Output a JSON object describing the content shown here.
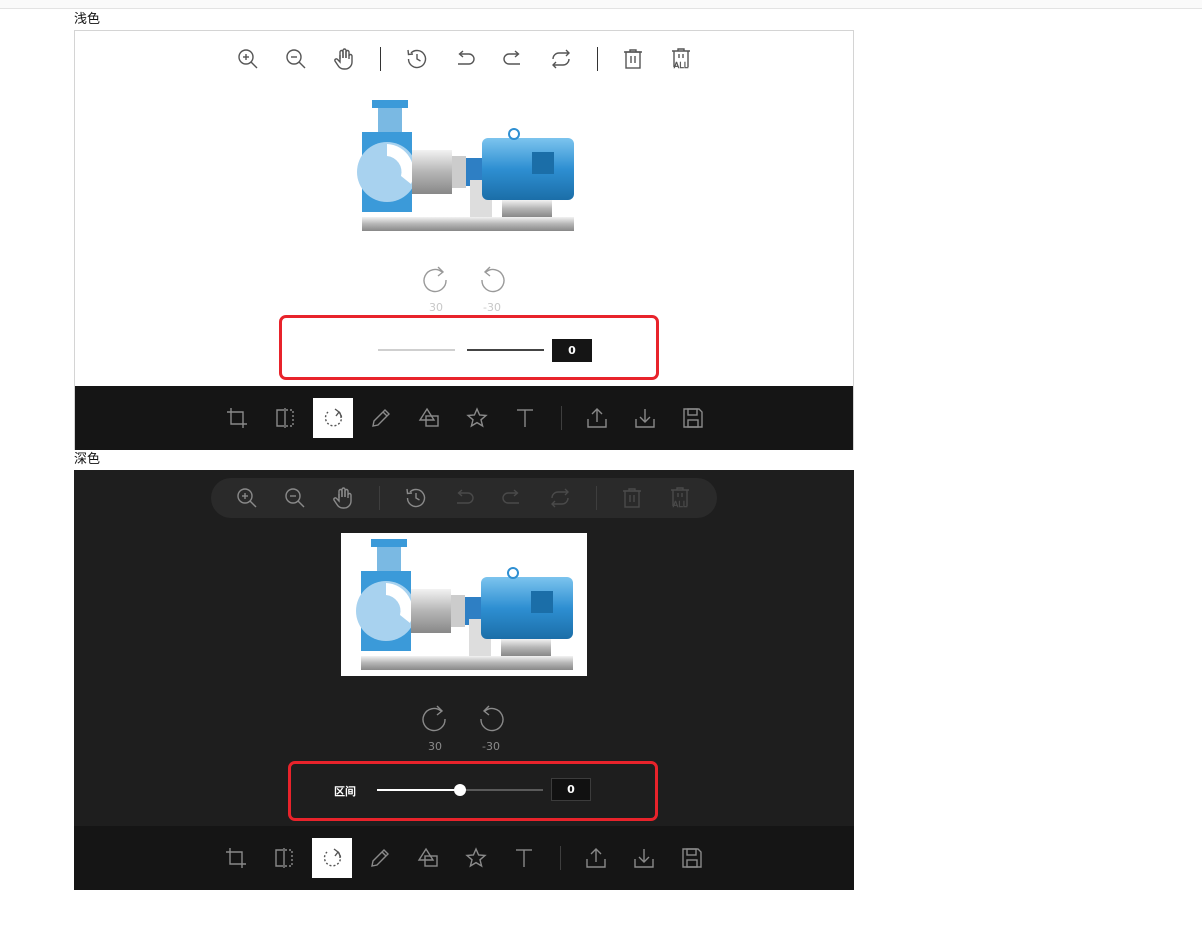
{
  "sections": [
    {
      "label": "浅色",
      "theme": "light"
    },
    {
      "label": "深色",
      "theme": "dark"
    }
  ],
  "header_icons": [
    "zoom-in-icon",
    "zoom-out-icon",
    "hand-icon",
    "history-icon",
    "undo-icon",
    "redo-icon",
    "reset-icon",
    "delete-icon",
    "delete-all-icon"
  ],
  "header_text": {
    "delete_all": "ALL"
  },
  "rotate": {
    "cw_label": "30",
    "ccw_label": "-30"
  },
  "range": {
    "label": "区间",
    "value": "0",
    "slider_fraction": 0.5
  },
  "menu_icons": [
    "crop-icon",
    "flip-icon",
    "rotate-icon",
    "draw-icon",
    "shape-icon",
    "icon-star-icon",
    "text-icon",
    "upload-icon",
    "download-icon",
    "save-icon"
  ],
  "active_menu": "rotate",
  "colors": {
    "highlight": "#e8232b",
    "menu_bg": "#151515",
    "dark_bg": "#1e1e1e"
  }
}
